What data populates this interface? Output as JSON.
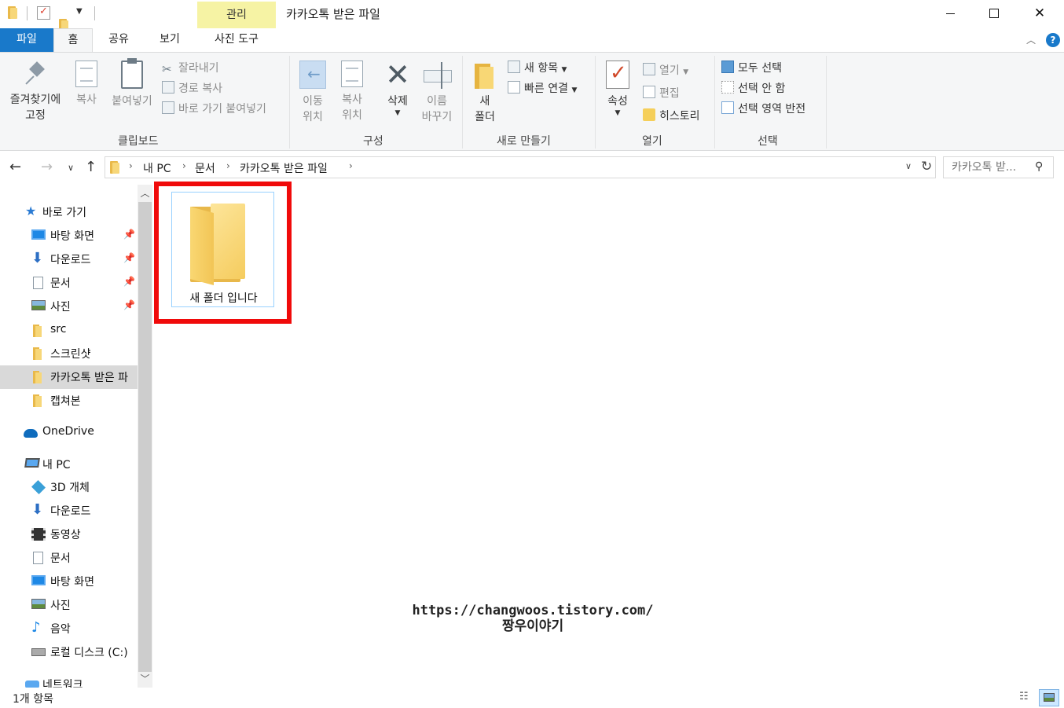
{
  "window": {
    "title": "카카오톡 받은 파일",
    "context_tab": "관리",
    "close_glyph": "✕"
  },
  "ribbon_tabs": {
    "file": "파일",
    "home": "홈",
    "share": "공유",
    "view": "보기",
    "picture_tools": "사진 도구"
  },
  "ribbon": {
    "clipboard": {
      "label": "클립보드",
      "pin_to_quick_access": "즐겨찾기에\n고정",
      "copy": "복사",
      "paste": "붙여넣기",
      "cut": "잘라내기",
      "copy_path": "경로 복사",
      "paste_shortcut": "바로 가기 붙여넣기"
    },
    "organize": {
      "label": "구성",
      "move_to": "이동\n위치",
      "copy_to": "복사\n위치",
      "delete": "삭제",
      "rename": "이름\n바꾸기"
    },
    "new": {
      "label": "새로 만들기",
      "new_folder": "새\n폴더",
      "new_item": "새 항목",
      "easy_access": "빠른 연결"
    },
    "open": {
      "label": "열기",
      "properties": "속성",
      "open": "열기",
      "edit": "편집",
      "history": "히스토리"
    },
    "select": {
      "label": "선택",
      "select_all": "모두 선택",
      "select_none": "선택 안 함",
      "invert": "선택 영역 반전"
    }
  },
  "address": {
    "crumbs": [
      "내 PC",
      "문서",
      "카카오톡 받은 파일"
    ],
    "search_placeholder": "카카오톡 받..."
  },
  "nav": {
    "quick_access": "바로 가기",
    "items": [
      {
        "label": "바탕 화면",
        "pinned": true
      },
      {
        "label": "다운로드",
        "pinned": true
      },
      {
        "label": "문서",
        "pinned": true
      },
      {
        "label": "사진",
        "pinned": true
      },
      {
        "label": "src"
      },
      {
        "label": "스크린샷"
      },
      {
        "label": "카카오톡 받은 파",
        "selected": true
      },
      {
        "label": "캡쳐본"
      }
    ],
    "onedrive": "OneDrive",
    "this_pc": "내 PC",
    "pc_items": [
      "3D 개체",
      "다운로드",
      "동영상",
      "문서",
      "바탕 화면",
      "사진",
      "음악",
      "로컬 디스크 (C:)"
    ],
    "network": "네트워크"
  },
  "content": {
    "items": [
      {
        "name": "새 폴더 입니다",
        "type": "folder"
      }
    ],
    "highlight_color": "#f00a0a"
  },
  "watermark": {
    "line1": "https://changwoos.tistory.com/",
    "line2": "짱우이야기"
  },
  "status": {
    "count": "1개 항목"
  },
  "colors": {
    "accent": "#1979ca",
    "context_tab_bg": "#f6f3a4",
    "selected_nav": "#d9d9d9"
  }
}
